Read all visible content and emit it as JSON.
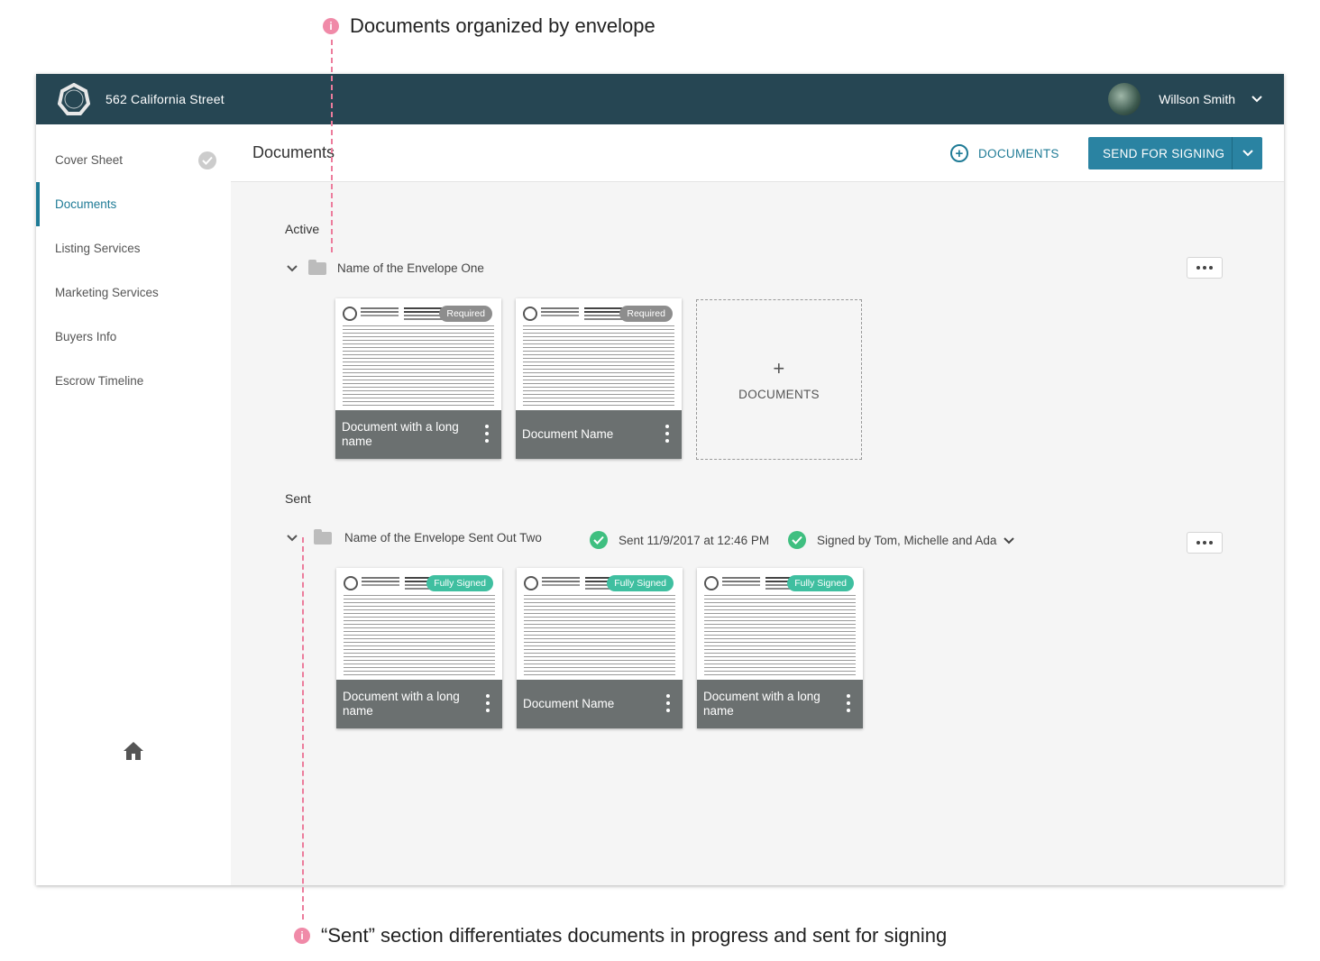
{
  "annotations": {
    "top": "Documents organized by envelope",
    "bottom": "“Sent” section differentiates documents in progress and sent for signing"
  },
  "topbar": {
    "address": "562 California Street",
    "user_name": "Willson Smith"
  },
  "sidebar": {
    "items": [
      {
        "label": "Cover Sheet"
      },
      {
        "label": "Documents"
      },
      {
        "label": "Listing Services"
      },
      {
        "label": "Marketing Services"
      },
      {
        "label": "Buyers Info"
      },
      {
        "label": "Escrow Timeline"
      }
    ]
  },
  "header": {
    "title": "Documents",
    "add_label": "DOCUMENTS",
    "send_label": "SEND FOR SIGNING"
  },
  "active": {
    "section_label": "Active",
    "envelope_name": "Name of the Envelope One",
    "add_card_label": "DOCUMENTS",
    "docs": [
      {
        "name": "Document with a long name",
        "badge": "Required"
      },
      {
        "name": "Document Name",
        "badge": "Required"
      }
    ]
  },
  "sent": {
    "section_label": "Sent",
    "envelope_name": "Name of the Envelope Sent Out Two",
    "sent_status": "Sent 11/9/2017 at 12:46 PM",
    "signed_status": "Signed by Tom, Michelle and Ada",
    "docs": [
      {
        "name": "Document with a long name",
        "badge": "Fully Signed"
      },
      {
        "name": "Document Name",
        "badge": "Fully Signed"
      },
      {
        "name": "Document with a long name",
        "badge": "Fully Signed"
      }
    ]
  },
  "colors": {
    "topbar": "#264653",
    "accent": "#1f7b96",
    "button": "#2a83a2",
    "fully_signed": "#3fbfa0",
    "required": "#8d8d8d",
    "annotation": "#ec7c9c"
  },
  "icons": [
    "logo-icon",
    "chevron-down-icon",
    "check-icon",
    "home-icon",
    "plus-circle-icon",
    "folder-icon",
    "more-icon",
    "kebab-icon",
    "info-icon"
  ]
}
